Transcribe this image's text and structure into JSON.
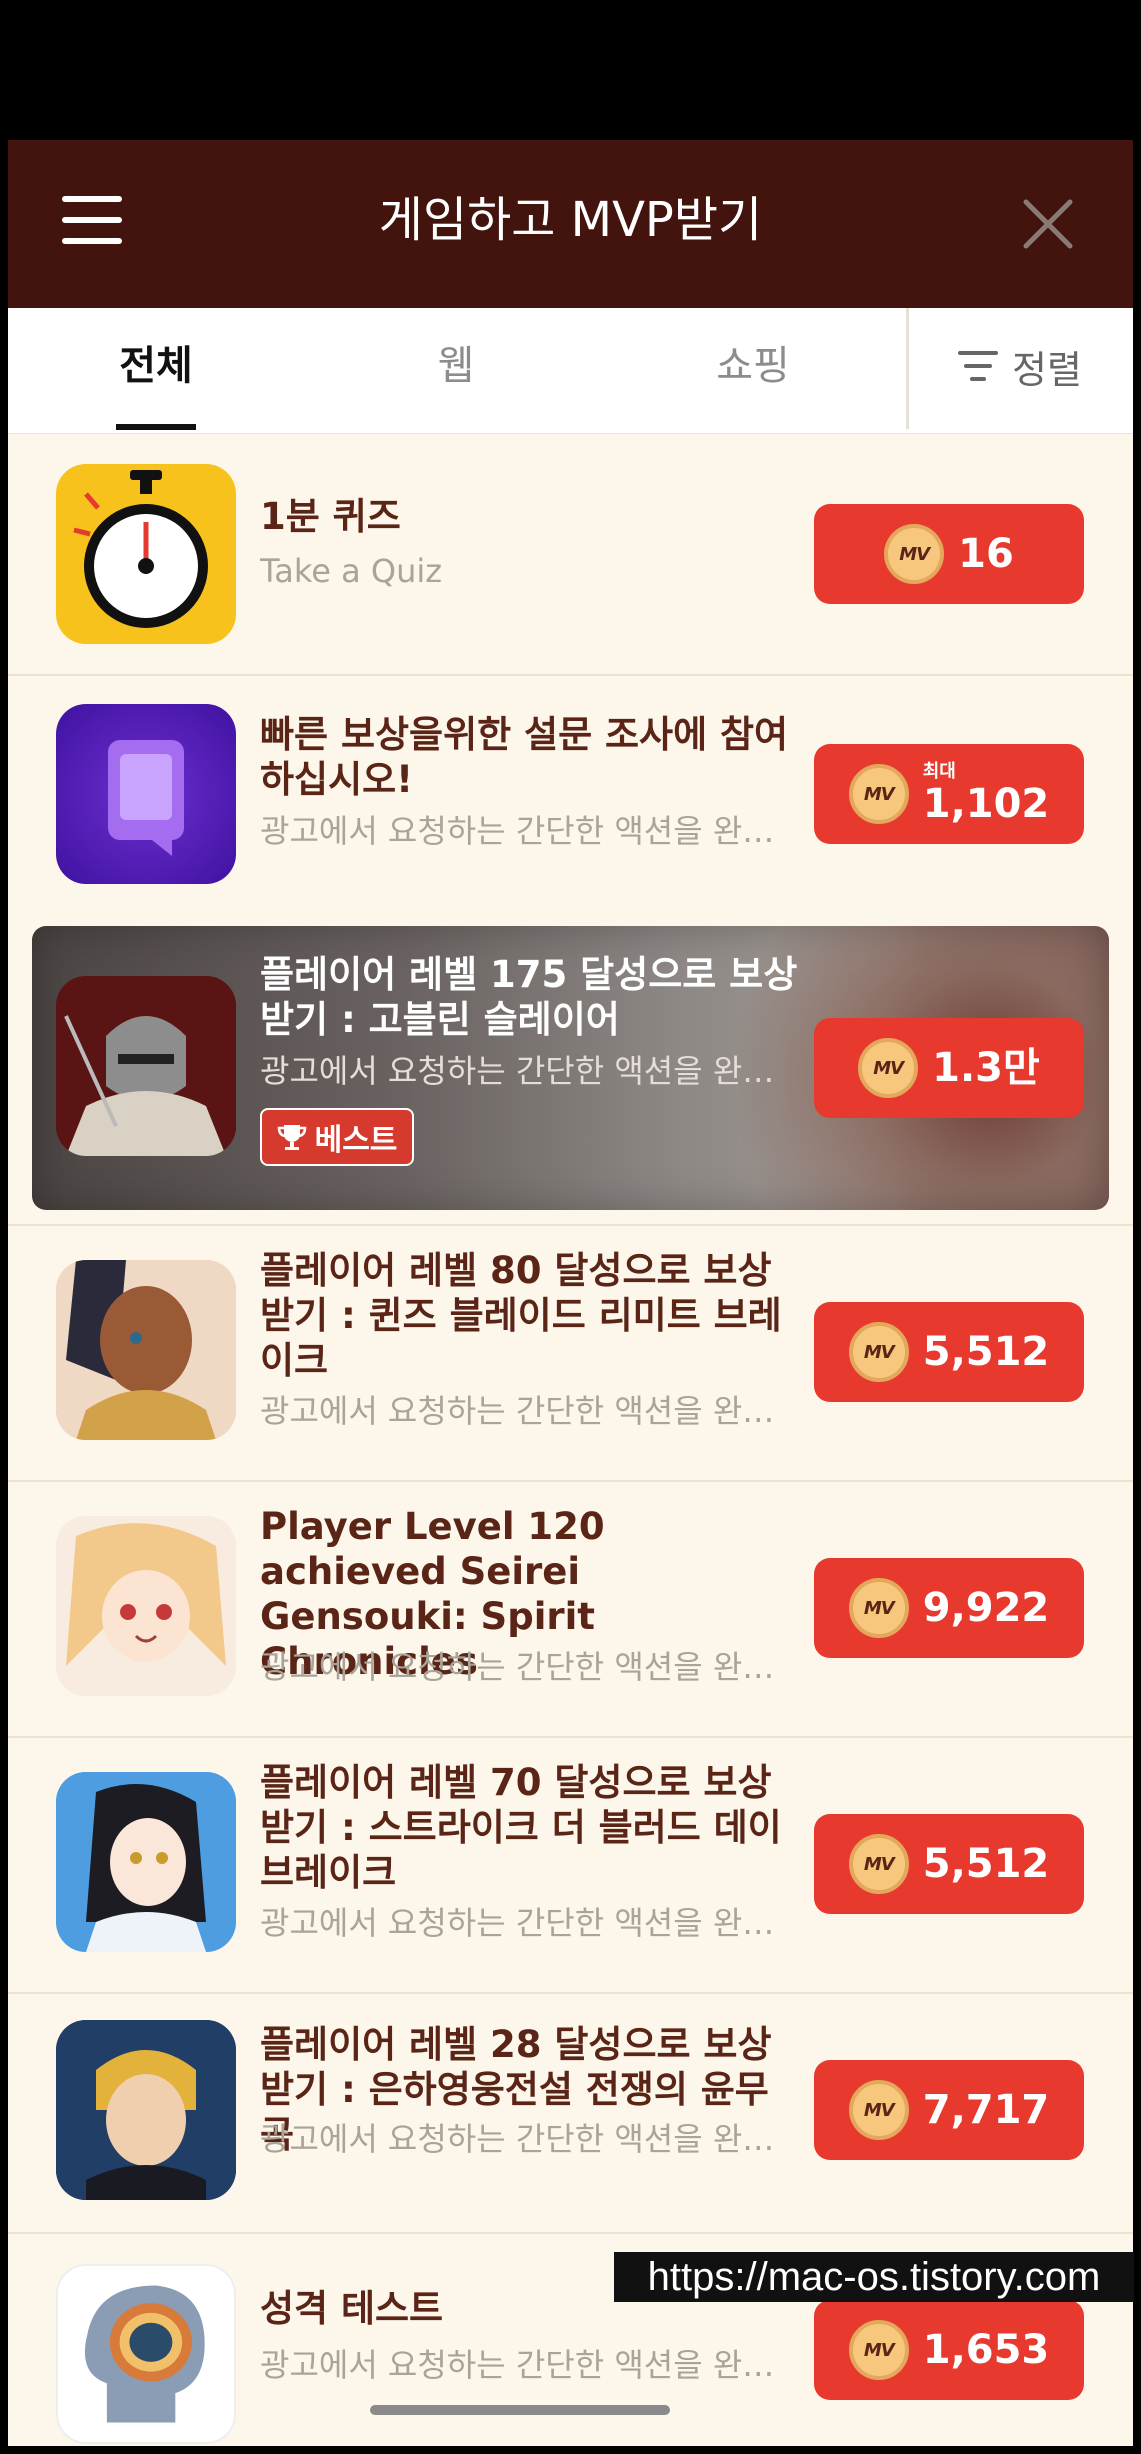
{
  "header": {
    "title": "게임하고 MVP받기"
  },
  "tabs": [
    {
      "label": "전체",
      "active": true
    },
    {
      "label": "웹",
      "active": false
    },
    {
      "label": "쇼핑",
      "active": false
    }
  ],
  "sort_label": "정렬",
  "coin_label": "MV",
  "offers": [
    {
      "title": "1분 퀴즈",
      "subtitle": "Take a Quiz",
      "reward": "16",
      "reward_prefix": "",
      "icon": "stopwatch-icon"
    },
    {
      "title": "빠른 보상을위한 설문 조사에 참여하십시오!",
      "subtitle": "광고에서 요청하는 간단한 액션을 완료...",
      "reward": "1,102",
      "reward_prefix": "최대",
      "icon": "survey-icon"
    },
    {
      "title": "플레이어 레벨 175 달성으로 보상 받기 : 고블린 슬레이어",
      "subtitle": "광고에서 요청하는 간단한 액션을 완료...",
      "reward": "1.3만",
      "reward_prefix": "",
      "badge": "베스트",
      "icon": "goblin-slayer-app-icon"
    },
    {
      "title": "플레이어 레벨 80 달성으로 보상 받기 : 퀸즈 블레이드 리미트 브레이크",
      "subtitle": "광고에서 요청하는 간단한 액션을 완료...",
      "reward": "5,512",
      "reward_prefix": "",
      "icon": "queens-blade-app-icon"
    },
    {
      "title": "Player Level 120 achieved Seirei Gensouki: Spirit Chronicles",
      "subtitle": "광고에서 요청하는 간단한 액션을 완료...",
      "reward": "9,922",
      "reward_prefix": "",
      "icon": "seirei-gensouki-app-icon"
    },
    {
      "title": "플레이어 레벨 70 달성으로 보상 받기 : 스트라이크 더 블러드 데이브레이크",
      "subtitle": "광고에서 요청하는 간단한 액션을 완료...",
      "reward": "5,512",
      "reward_prefix": "",
      "icon": "strike-the-blood-app-icon"
    },
    {
      "title": "플레이어 레벨 28 달성으로 보상 받기 : 은하영웅전설 전쟁의 윤무곡",
      "subtitle": "광고에서 요청하는 간단한 액션을 완료...",
      "reward": "7,717",
      "reward_prefix": "",
      "icon": "galactic-heroes-app-icon"
    },
    {
      "title": "성격 테스트",
      "subtitle": "광고에서 요청하는 간단한 액션을 완료...",
      "reward": "1,653",
      "reward_prefix": "",
      "icon": "personality-test-icon"
    }
  ],
  "watermark": "https://mac-os.tistory.com"
}
